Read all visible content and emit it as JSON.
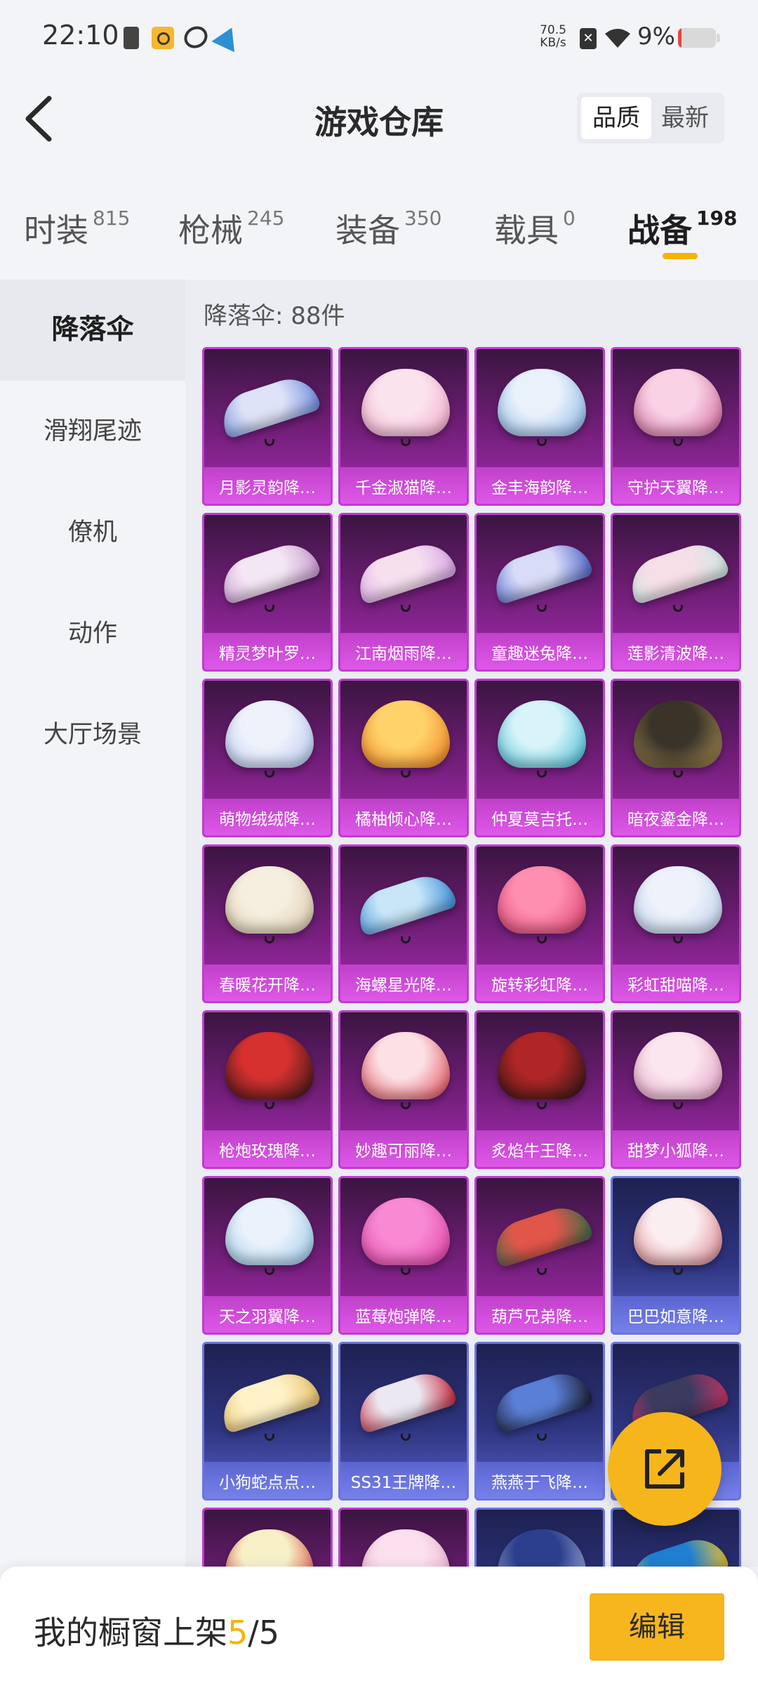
{
  "status_bar": {
    "time": "22:10",
    "net_speed_value": "70.5",
    "net_speed_unit": "KB/s",
    "battery_percent_text": "9%",
    "battery_level": 0.09,
    "battery_color": "#e8463d"
  },
  "header": {
    "title": "游戏仓库",
    "back_icon": "chevron-left-icon",
    "sort": {
      "options": [
        "品质",
        "最新"
      ],
      "selected": "品质"
    }
  },
  "tabs": [
    {
      "label": "时装",
      "count": "815"
    },
    {
      "label": "枪械",
      "count": "245"
    },
    {
      "label": "装备",
      "count": "350"
    },
    {
      "label": "载具",
      "count": "0"
    },
    {
      "label": "战备",
      "count": "198",
      "active": true
    }
  ],
  "accent_color": "#f5b400",
  "sidebar": {
    "items": [
      {
        "label": "降落伞",
        "active": true
      },
      {
        "label": "滑翔尾迹"
      },
      {
        "label": "僚机"
      },
      {
        "label": "动作"
      },
      {
        "label": "大厅场景"
      }
    ]
  },
  "content": {
    "count_text": "降落伞: 88件",
    "items": [
      {
        "name": "月影灵韵降…",
        "rarity": "purple",
        "colors": [
          "#dfe3f7",
          "#6d8be0"
        ],
        "shape": "flat"
      },
      {
        "name": "千金淑猫降…",
        "rarity": "purple",
        "colors": [
          "#fbe3ee",
          "#f2a6c6"
        ],
        "shape": "round"
      },
      {
        "name": "金丰海韵降…",
        "rarity": "purple",
        "colors": [
          "#e9f1fb",
          "#7fb1e6"
        ],
        "shape": "round"
      },
      {
        "name": "守护天翼降…",
        "rarity": "purple",
        "colors": [
          "#f9d3e5",
          "#cf5f95"
        ],
        "shape": "round"
      },
      {
        "name": "精灵梦叶罗…",
        "rarity": "purple",
        "colors": [
          "#f3e7f3",
          "#c99ad0"
        ],
        "shape": "flat"
      },
      {
        "name": "江南烟雨降…",
        "rarity": "purple",
        "colors": [
          "#f7e0ee",
          "#d7a5e6"
        ],
        "shape": "flat"
      },
      {
        "name": "童趣迷兔降…",
        "rarity": "purple",
        "colors": [
          "#d9dcf8",
          "#4c63c9"
        ],
        "shape": "flat"
      },
      {
        "name": "莲影清波降…",
        "rarity": "purple",
        "colors": [
          "#f6dfe6",
          "#cde8e4"
        ],
        "shape": "flat"
      },
      {
        "name": "萌物绒绒降…",
        "rarity": "purple",
        "colors": [
          "#eef2fb",
          "#b3c4ee"
        ],
        "shape": "round"
      },
      {
        "name": "橘柚倾心降…",
        "rarity": "purple",
        "colors": [
          "#ffd36a",
          "#f07a1d"
        ],
        "shape": "round"
      },
      {
        "name": "仲夏莫吉托…",
        "rarity": "purple",
        "colors": [
          "#d8f4f8",
          "#3ab7d6"
        ],
        "shape": "round"
      },
      {
        "name": "暗夜鎏金降…",
        "rarity": "purple",
        "colors": [
          "#3a3328",
          "#b29659"
        ],
        "shape": "round"
      },
      {
        "name": "春暖花开降…",
        "rarity": "purple",
        "colors": [
          "#f6efe0",
          "#d7c6a4"
        ],
        "shape": "round"
      },
      {
        "name": "海螺星光降…",
        "rarity": "purple",
        "colors": [
          "#c8e6f8",
          "#3b8fd9"
        ],
        "shape": "flat"
      },
      {
        "name": "旋转彩虹降…",
        "rarity": "purple",
        "colors": [
          "#ff8fb1",
          "#d83b6c"
        ],
        "shape": "round"
      },
      {
        "name": "彩虹甜喵降…",
        "rarity": "purple",
        "colors": [
          "#eef3fb",
          "#b7cbe9"
        ],
        "shape": "round"
      },
      {
        "name": "枪炮玫瑰降…",
        "rarity": "purple",
        "colors": [
          "#d6312f",
          "#2a1414"
        ],
        "shape": "round"
      },
      {
        "name": "妙趣可丽降…",
        "rarity": "purple",
        "colors": [
          "#fbe0e4",
          "#e2414f"
        ],
        "shape": "round"
      },
      {
        "name": "炙焰牛王降…",
        "rarity": "purple",
        "colors": [
          "#b02626",
          "#201414"
        ],
        "shape": "round"
      },
      {
        "name": "甜梦小狐降…",
        "rarity": "purple",
        "colors": [
          "#fbe5ef",
          "#e09bbd"
        ],
        "shape": "round"
      },
      {
        "name": "天之羽翼降…",
        "rarity": "purple",
        "colors": [
          "#eaf2fb",
          "#93c4e6"
        ],
        "shape": "round"
      },
      {
        "name": "蓝莓炮弹降…",
        "rarity": "purple",
        "colors": [
          "#f78ad2",
          "#e23ea6"
        ],
        "shape": "round"
      },
      {
        "name": "葫芦兄弟降…",
        "rarity": "purple",
        "colors": [
          "#e2564a",
          "#3a6c4a"
        ],
        "shape": "flat"
      },
      {
        "name": "巴巴如意降…",
        "rarity": "blue",
        "colors": [
          "#fbeef0",
          "#d77b84"
        ],
        "shape": "round"
      },
      {
        "name": "小狗蛇点点…",
        "rarity": "blue",
        "colors": [
          "#fff2c8",
          "#e7c06a"
        ],
        "shape": "flat"
      },
      {
        "name": "SS31王牌降…",
        "rarity": "blue",
        "colors": [
          "#ece8f2",
          "#c8243a"
        ],
        "shape": "flat"
      },
      {
        "name": "燕燕于飞降…",
        "rarity": "blue",
        "colors": [
          "#5a7fd6",
          "#1d1d2e"
        ],
        "shape": "flat"
      },
      {
        "name": "",
        "rarity": "blue",
        "colors": [
          "#3b3b60",
          "#d0356a"
        ],
        "shape": "flat"
      },
      {
        "name": "",
        "rarity": "purple",
        "colors": [
          "#f8f1c8",
          "#d6352c"
        ],
        "shape": "round"
      },
      {
        "name": "",
        "rarity": "purple",
        "colors": [
          "#fbe0ee",
          "#e7a7c6"
        ],
        "shape": "round"
      },
      {
        "name": "",
        "rarity": "blue",
        "colors": [
          "#2c3f8c",
          "#b7c2ef"
        ],
        "shape": "round"
      },
      {
        "name": "",
        "rarity": "blue",
        "colors": [
          "#1f7fd0",
          "#f7c72a"
        ],
        "shape": "flat"
      }
    ]
  },
  "share_fab": {
    "icon": "share-icon"
  },
  "bottom_bar": {
    "label": "我的橱窗上架",
    "count_current": "5",
    "count_total": "/5",
    "edit_label": "编辑"
  }
}
